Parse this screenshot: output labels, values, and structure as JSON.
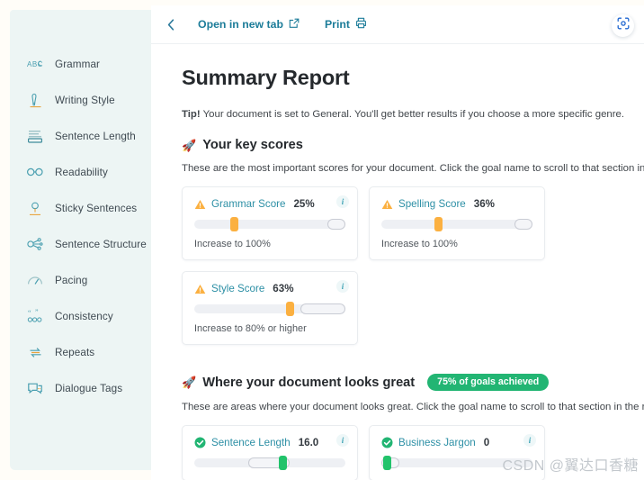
{
  "sidebar": {
    "items": [
      {
        "label": "Grammar",
        "icon": "abc-icon"
      },
      {
        "label": "Writing Style",
        "icon": "pen-icon"
      },
      {
        "label": "Sentence Length",
        "icon": "lines-icon"
      },
      {
        "label": "Readability",
        "icon": "glasses-icon"
      },
      {
        "label": "Sticky Sentences",
        "icon": "honey-dipper-icon"
      },
      {
        "label": "Sentence Structure",
        "icon": "node-graph-icon"
      },
      {
        "label": "Pacing",
        "icon": "gauge-icon"
      },
      {
        "label": "Consistency",
        "icon": "quotes-dots-icon"
      },
      {
        "label": "Repeats",
        "icon": "repeat-arrows-icon"
      },
      {
        "label": "Dialogue Tags",
        "icon": "speech-bubbles-icon"
      }
    ]
  },
  "topbar": {
    "back_icon": "chevron-left-icon",
    "open_in_new_tab": "Open in new tab",
    "open_in_new_tab_icon": "external-link-icon",
    "print": "Print",
    "print_icon": "printer-icon",
    "scan_icon": "scan-focus-icon"
  },
  "report": {
    "title": "Summary Report",
    "tip_label": "Tip!",
    "tip_text": " Your document is set to General. You'll get better results if you choose a more specific genre.",
    "sections": [
      {
        "rocket": "🚀",
        "heading": "Your key scores",
        "badge": null,
        "subtext": "These are the most important scores for your document. Click the goal name to scroll to that section in the report.",
        "cards": [
          {
            "status": "warning",
            "name": "Grammar Score",
            "value": "25%",
            "info_icon": "info-icon",
            "has_info": true,
            "slider": {
              "thumb_pct": 25,
              "goal_start_pct": 92,
              "goal_end_pct": 100,
              "thumb_color": "#fbb040"
            },
            "footer": "Increase to 100%"
          },
          {
            "status": "warning",
            "name": "Spelling Score",
            "value": "36%",
            "info_icon": "info-icon",
            "has_info": false,
            "slider": {
              "thumb_pct": 36,
              "goal_start_pct": 92,
              "goal_end_pct": 100,
              "thumb_color": "#fbb040"
            },
            "footer": "Increase to 100%"
          },
          {
            "status": "warning",
            "name": "Style Score",
            "value": "63%",
            "info_icon": "info-icon",
            "has_info": true,
            "slider": {
              "thumb_pct": 63,
              "goal_start_pct": 72,
              "goal_end_pct": 100,
              "thumb_color": "#fbb040"
            },
            "footer": "Increase to 80% or higher"
          }
        ]
      },
      {
        "rocket": "🚀",
        "heading": "Where your document looks great",
        "badge": "75% of goals achieved",
        "badge_color": "#22b573",
        "subtext": "These are areas where your document looks great. Click the goal name to scroll to that section in the report.",
        "cards": [
          {
            "status": "good",
            "name": "Sentence Length",
            "value": "16.0",
            "info_icon": "info-icon",
            "has_info": true,
            "slider": {
              "thumb_pct": 57,
              "goal_start_pct": 37,
              "goal_end_pct": 62,
              "thumb_color": "#22c36b"
            },
            "footer": null
          },
          {
            "status": "good",
            "name": "Business Jargon",
            "value": "0",
            "info_icon": "info-icon",
            "has_info": true,
            "slider": {
              "thumb_pct": 2,
              "goal_start_pct": 0,
              "goal_end_pct": 12,
              "thumb_color": "#22c36b"
            },
            "footer": null
          }
        ]
      }
    ]
  },
  "watermark": "CSDN @翼达口香糖",
  "colors": {
    "sidebar_bg": "#edf5f4",
    "link": "#1c7c99",
    "card_name": "#2c8fa5",
    "warning": "#fbb040",
    "good": "#22c36b",
    "badge": "#22b573"
  }
}
